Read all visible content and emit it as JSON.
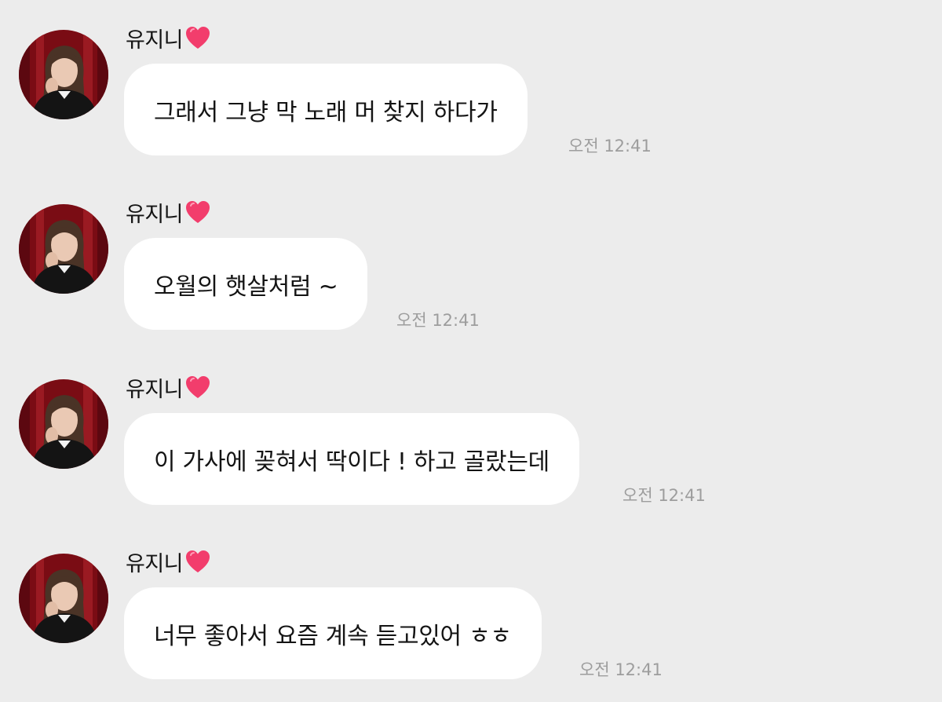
{
  "chat": {
    "messages": [
      {
        "sender": "유지니",
        "text": "그래서 그냥 막 노래 머 찾지 하다가",
        "time": "오전 12:41"
      },
      {
        "sender": "유지니",
        "text": "오월의 햇살처럼 ~",
        "time": "오전 12:41"
      },
      {
        "sender": "유지니",
        "text": "이 가사에 꽂혀서 딱이다 ! 하고 골랐는데",
        "time": "오전 12:41"
      },
      {
        "sender": "유지니",
        "text": "너무 좋아서 요즘 계속 듣고있어 ㅎㅎ",
        "time": "오전 12:41"
      }
    ]
  },
  "icons": {
    "sender_suffix": "heart-icon",
    "avatar": "profile-photo"
  },
  "colors": {
    "background": "#ececec",
    "bubble": "#ffffff",
    "heart": "#f23d6c",
    "timestamp": "#9d9d9d",
    "avatar_backdrop": "#7a0c14"
  }
}
